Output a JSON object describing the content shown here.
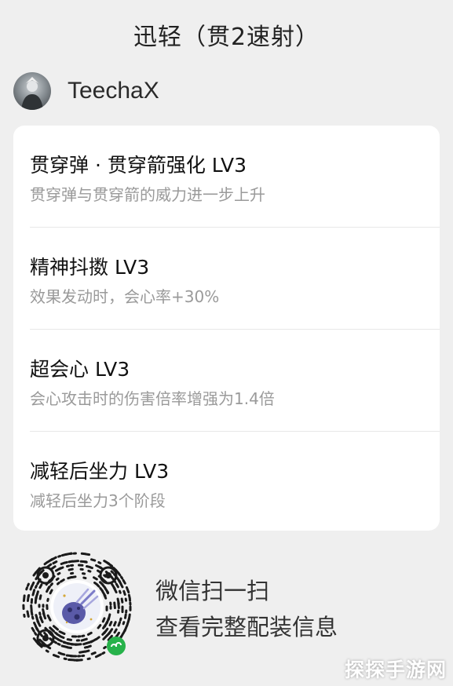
{
  "header": {
    "title": "迅轻（贯2速射）"
  },
  "author": {
    "name": "TeechaX"
  },
  "skills": [
    {
      "name": "贯穿弹 · 贯穿箭强化 LV3",
      "desc": "贯穿弹与贯穿箭的威力进一步上升"
    },
    {
      "name": "精神抖擞 LV3",
      "desc": "效果发动时，会心率+30%"
    },
    {
      "name": "超会心 LV3",
      "desc": "会心攻击时的伤害倍率增强为1.4倍"
    },
    {
      "name": "减轻后坐力 LV3",
      "desc": "减轻后坐力3个阶段"
    }
  ],
  "footer": {
    "line1": "微信扫一扫",
    "line2": "查看完整配装信息"
  },
  "watermark": "探探手游网",
  "colors": {
    "background": "#efefef",
    "card": "#ffffff",
    "wechat_green": "#27b24a"
  }
}
